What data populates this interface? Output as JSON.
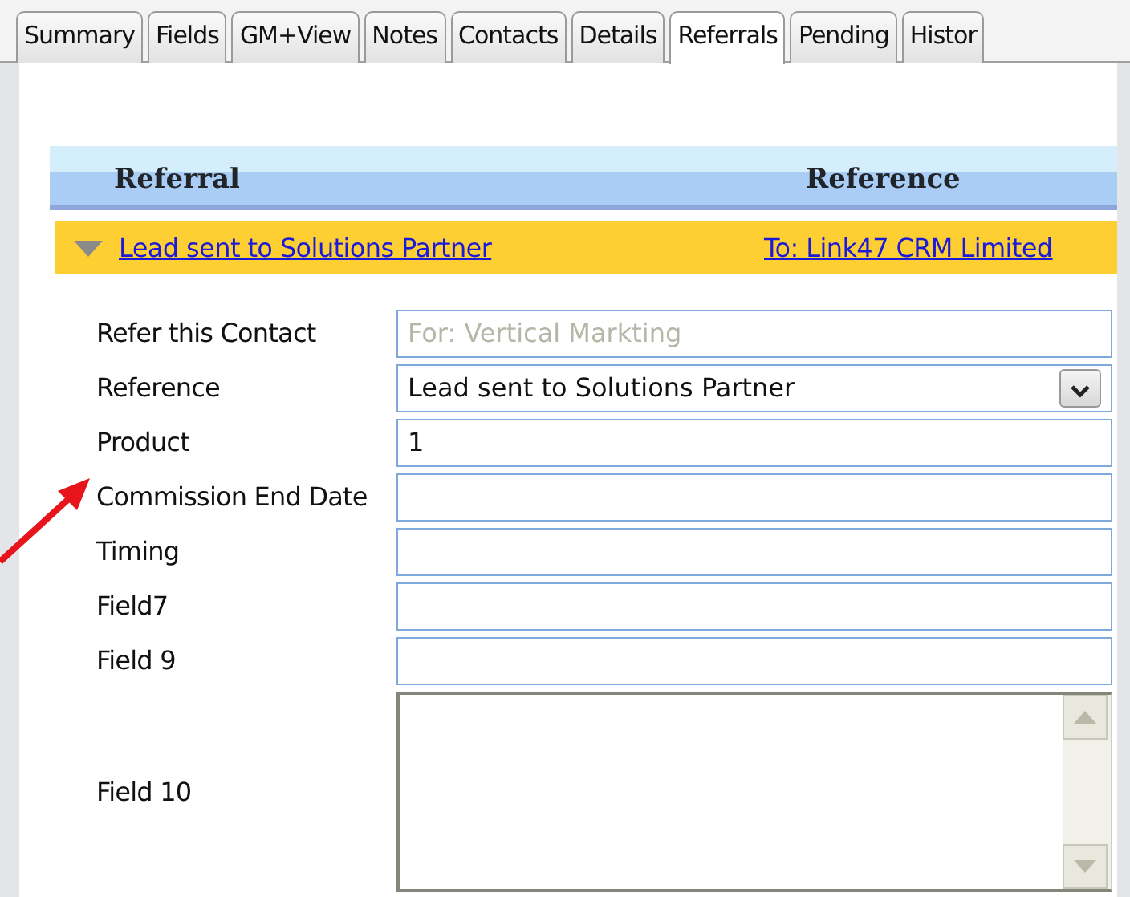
{
  "tabs": [
    {
      "label": "Summary",
      "selected": false
    },
    {
      "label": "Fields",
      "selected": false
    },
    {
      "label": "GM+View",
      "selected": false
    },
    {
      "label": "Notes",
      "selected": false
    },
    {
      "label": "Contacts",
      "selected": false
    },
    {
      "label": "Details",
      "selected": false
    },
    {
      "label": "Referrals",
      "selected": true
    },
    {
      "label": "Pending",
      "selected": false
    },
    {
      "label": "Histor",
      "selected": false
    }
  ],
  "referrals": {
    "columns": [
      "Referral",
      "Reference"
    ],
    "rows": [
      {
        "referral": "Lead sent to Solutions Partner",
        "reference": "To: Link47 CRM Limited",
        "expanded": true
      }
    ]
  },
  "form": [
    {
      "label": "Refer this Contact",
      "kind": "readonly",
      "value": "For: Vertical Markting"
    },
    {
      "label": "Reference",
      "kind": "select",
      "value": "Lead sent to Solutions Partner"
    },
    {
      "label": "Product",
      "kind": "text",
      "value": "1"
    },
    {
      "label": "Commission End Date",
      "kind": "text"
    },
    {
      "label": "Timing",
      "kind": "text"
    },
    {
      "label": "Field7",
      "kind": "text"
    },
    {
      "label": "Field 9",
      "kind": "text"
    },
    {
      "label": "Field 10",
      "kind": "textarea"
    }
  ]
}
